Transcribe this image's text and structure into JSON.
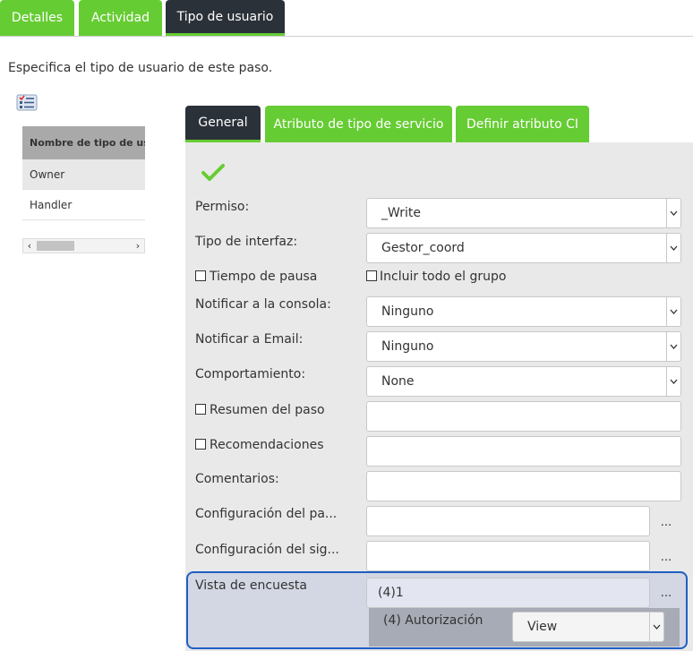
{
  "top_tabs": [
    {
      "label": "Detalles"
    },
    {
      "label": "Actividad"
    },
    {
      "label": "Tipo de usuario"
    }
  ],
  "intro": "Especifica el tipo de usuario de este paso.",
  "user_types": {
    "header": "Nombre de tipo de usuario",
    "rows": [
      "Owner",
      "Handler"
    ]
  },
  "sub_tabs": [
    {
      "label": "General"
    },
    {
      "label": "Atributo de tipo de servicio"
    },
    {
      "label": "Definir atributo CI"
    }
  ],
  "form": {
    "permiso_label": "Permiso:",
    "permiso_value": "_Write",
    "interfaz_label": "Tipo de interfaz:",
    "interfaz_value": "Gestor_coord",
    "pausa_label": "Tiempo de pausa",
    "grupo_label": "Incluir todo el grupo",
    "consola_label": "Notificar a la consola:",
    "consola_value": "Ninguno",
    "email_label": "Notificar a Email:",
    "email_value": "Ninguno",
    "comportamiento_label": "Comportamiento:",
    "comportamiento_value": "None",
    "resumen_label": "Resumen del paso",
    "recomendaciones_label": "Recomendaciones",
    "comentarios_label": "Comentarios:",
    "config_paso_label": "Configuración del pa...",
    "config_sig_label": "Configuración del sig...",
    "dots": "...",
    "encuesta_label": "Vista de encuesta",
    "encuesta_value": "(4)1",
    "autorizacion_label": "(4) Autorización",
    "autorizacion_value": "View"
  },
  "colors": {
    "accent_green": "#66cc33",
    "tab_dark": "#2b3139",
    "highlight_border": "#1f5fc4"
  }
}
